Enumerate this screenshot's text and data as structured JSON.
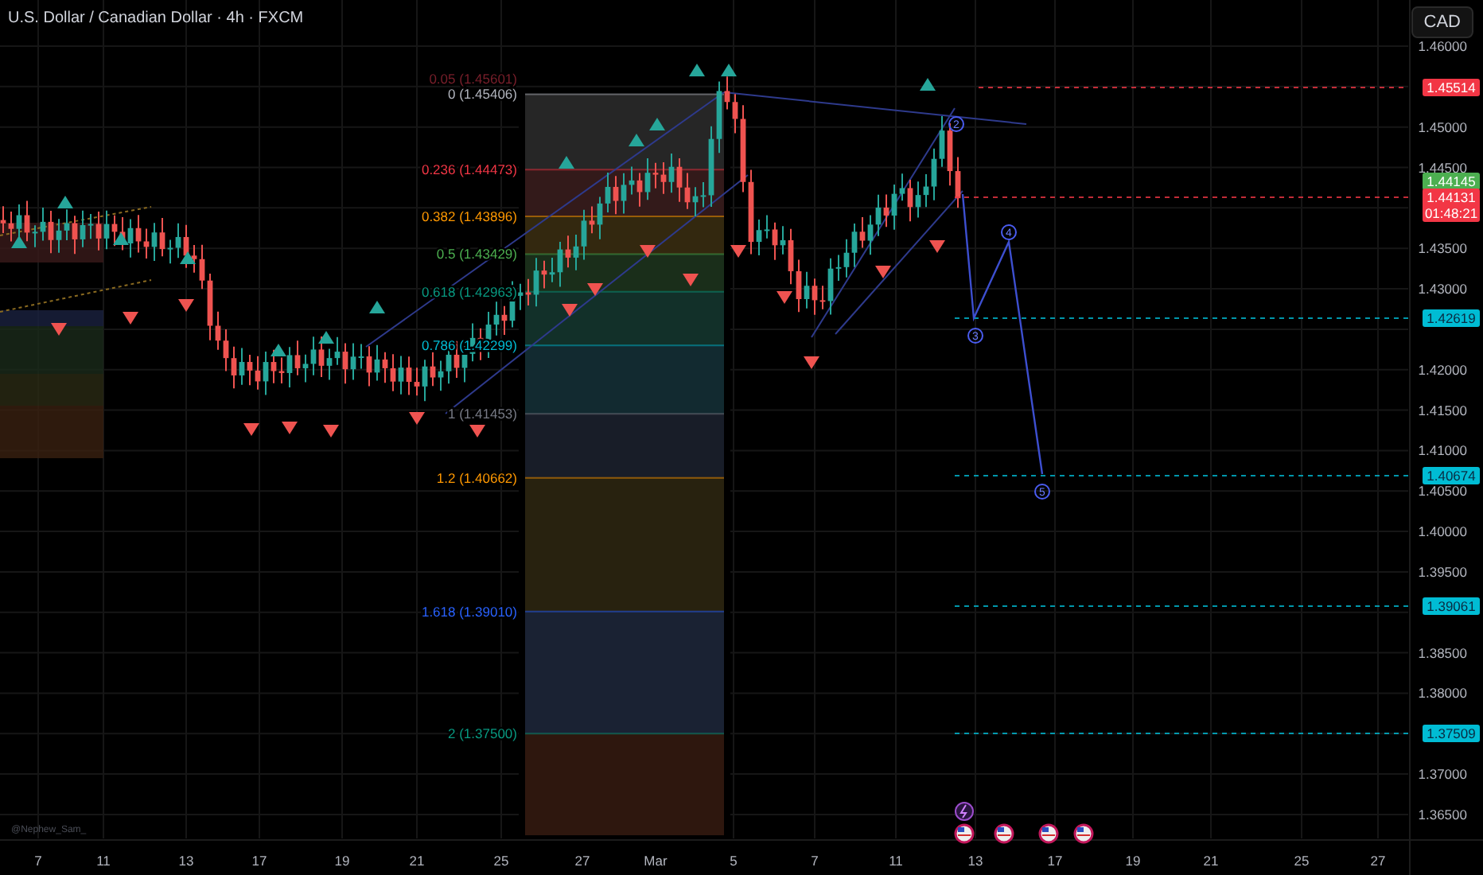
{
  "title": "U.S. Dollar / Canadian Dollar · 4h · FXCM",
  "currency_button": "CAD",
  "author": "@Nephew_Sam_",
  "price_axis": [
    "1.46000",
    "1.45000",
    "1.44500",
    "1.43500",
    "1.43000",
    "1.42000",
    "1.41500",
    "1.41000",
    "1.40500",
    "1.40000",
    "1.39500",
    "1.38500",
    "1.38000",
    "1.37000",
    "1.36500"
  ],
  "price_tags": [
    {
      "text": "1.45514",
      "color": "#f23645"
    },
    {
      "text": "1.44145",
      "color": "#4caf50"
    },
    {
      "text": "1.44131",
      "countdown": "01:48:21",
      "color": "#f23645"
    },
    {
      "text": "1.42619",
      "color": "#00bcd4"
    },
    {
      "text": "1.40674",
      "color": "#00bcd4"
    },
    {
      "text": "1.39061",
      "color": "#00bcd4"
    },
    {
      "text": "1.37509",
      "color": "#00bcd4"
    }
  ],
  "fib_levels": [
    {
      "label": "0.05 (1.45601)",
      "color": "#7a1f2b"
    },
    {
      "label": "0 (1.45406)",
      "color": "#b2b5be"
    },
    {
      "label": "0.236 (1.44473)",
      "color": "#f23645"
    },
    {
      "label": "0.382 (1.43896)",
      "color": "#ff9800"
    },
    {
      "label": "0.5 (1.43429)",
      "color": "#4caf50"
    },
    {
      "label": "0.618 (1.42963)",
      "color": "#089981"
    },
    {
      "label": "0.786 (1.42299)",
      "color": "#00bcd4"
    },
    {
      "label": "1 (1.41453)",
      "color": "#787b86"
    },
    {
      "label": "1.2 (1.40662)",
      "color": "#ff9800"
    },
    {
      "label": "1.618 (1.39010)",
      "color": "#2962ff"
    },
    {
      "label": "2 (1.37500)",
      "color": "#089981"
    }
  ],
  "wave_labels": [
    "2",
    "3",
    "4",
    "5"
  ],
  "date_axis": [
    "7",
    "11",
    "13",
    "17",
    "19",
    "21",
    "25",
    "27",
    "Mar",
    "5",
    "7",
    "11",
    "13",
    "17",
    "19",
    "21",
    "25",
    "27"
  ]
}
